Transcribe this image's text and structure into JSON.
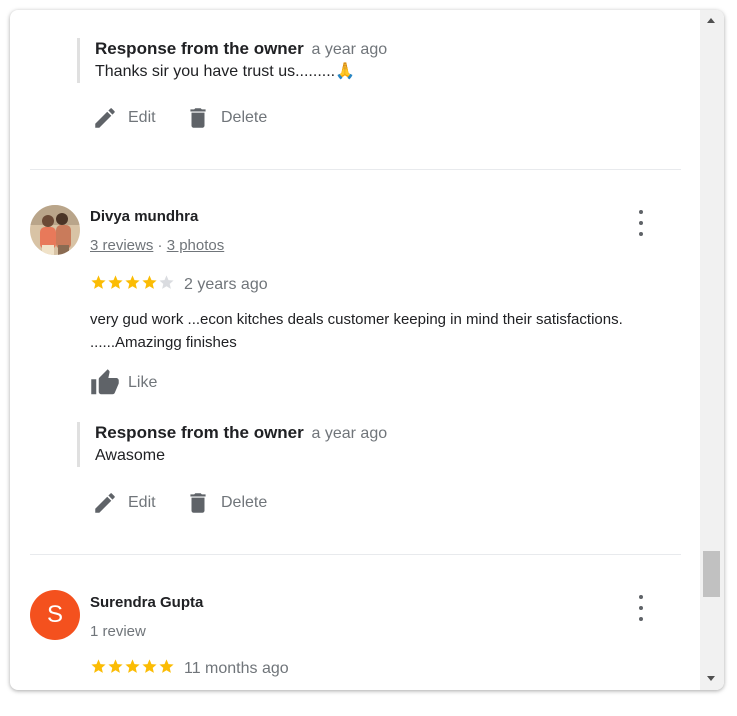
{
  "responses": [
    {
      "heading": "Response from the owner",
      "time": "a year ago",
      "text": "Thanks sir you have trust us.........🙏"
    },
    {
      "heading": "Response from the owner",
      "time": "a year ago",
      "text": "Awasome"
    }
  ],
  "actions": {
    "edit": "Edit",
    "delete": "Delete",
    "like": "Like"
  },
  "reviews": [
    {
      "name": "Divya mundhra",
      "reviews_link": "3 reviews",
      "separator": "·",
      "photos_link": "3 photos",
      "rating": 4,
      "time": "2 years ago",
      "text": "very gud work ...econ kitches deals customer keeping in mind their satisfactions. ......Amazingg finishes"
    },
    {
      "name": "Surendra Gupta",
      "avatar_letter": "S",
      "avatar_color": "#f4511e",
      "reviews_text": "1 review",
      "rating": 5,
      "time": "11 months ago"
    }
  ],
  "colors": {
    "star_filled": "#fbbc04",
    "star_empty": "#dadce0",
    "icon": "#5f6368"
  },
  "icons": [
    "pencil-icon",
    "trash-icon",
    "thumbs-up-icon",
    "more-vert-icon",
    "star-icon"
  ]
}
